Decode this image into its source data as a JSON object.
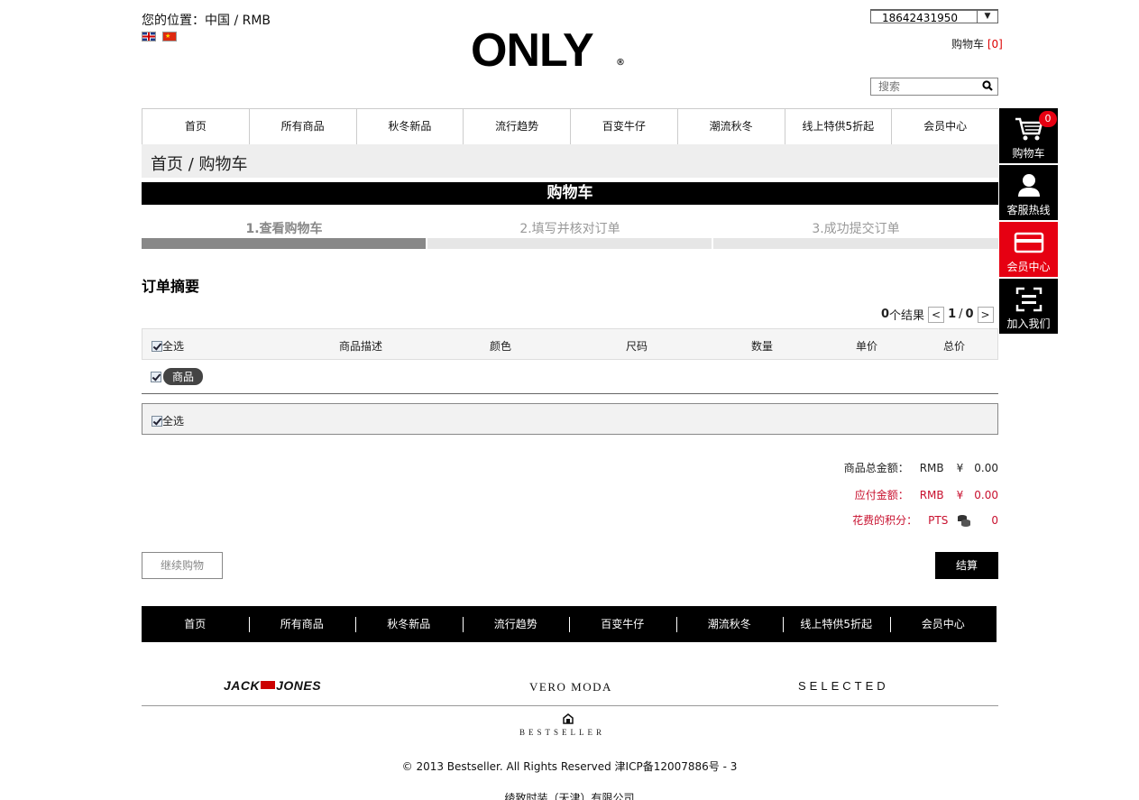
{
  "header": {
    "location": "您的位置：中国 / RMB",
    "flags": [
      "uk-flag",
      "china-flag"
    ],
    "logo_text": "ONLY",
    "logo_mark": "®",
    "account_value": "18642431950",
    "cart_label": "购物车",
    "cart_count": "[0]",
    "search_placeholder": "搜索"
  },
  "nav": {
    "items": [
      "首页",
      "所有商品",
      "秋冬新品",
      "流行趋势",
      "百变牛仔",
      "潮流秋冬",
      "线上特供5折起",
      "会员中心"
    ]
  },
  "breadcrumb": "首页 / 购物车",
  "cart_title": "购物车",
  "steps": [
    {
      "label": "1.查看购物车",
      "active": true
    },
    {
      "label": "2.填写并核对订单",
      "active": false
    },
    {
      "label": "3.成功提交订单",
      "active": false
    }
  ],
  "summary_title": "订单摘要",
  "pager": {
    "count": "0",
    "count_suffix": "个结果",
    "prev": "<",
    "page": "1",
    "sep": "/",
    "total": "0",
    "next": ">"
  },
  "table": {
    "select_all": "全选",
    "columns": [
      "商品描述",
      "颜色",
      "尺码",
      "数量",
      "单价",
      "总价"
    ],
    "group_label": "商品",
    "footer_select_all": "全选"
  },
  "totals": {
    "goods_label": "商品总金额：",
    "goods_currency": "RMB",
    "goods_yen": "¥",
    "goods_amount": "0.00",
    "payable_label": "应付金额：",
    "payable_currency": "RMB",
    "payable_yen": "¥",
    "payable_amount": "0.00",
    "points_label": "花费的积分：",
    "points_currency": "PTS",
    "points_amount": "0"
  },
  "buttons": {
    "continue": "继续购物",
    "checkout": "结算"
  },
  "footer": {
    "nav": [
      "首页",
      "所有商品",
      "秋冬新品",
      "流行趋势",
      "百变牛仔",
      "潮流秋冬",
      "线上特供5折起",
      "会员中心"
    ],
    "brand_jj_left": "JACK",
    "brand_jj_right": "JONES",
    "brand_vm": "VERO MODA",
    "brand_sel": "SELECTED",
    "bestseller": "BESTSELLER",
    "copyright": "© 2013 Bestseller. All Rights Reserved 津ICP备12007886号 - 3",
    "company": "绫致时装（天津）有限公司"
  },
  "rail": {
    "badge": "0",
    "items": [
      "购物车",
      "客服热线",
      "会员中心",
      "加入我们"
    ]
  },
  "colors": {
    "accent_red": "#e60012",
    "total_red": "#c8102e",
    "bar_black": "#000000"
  }
}
